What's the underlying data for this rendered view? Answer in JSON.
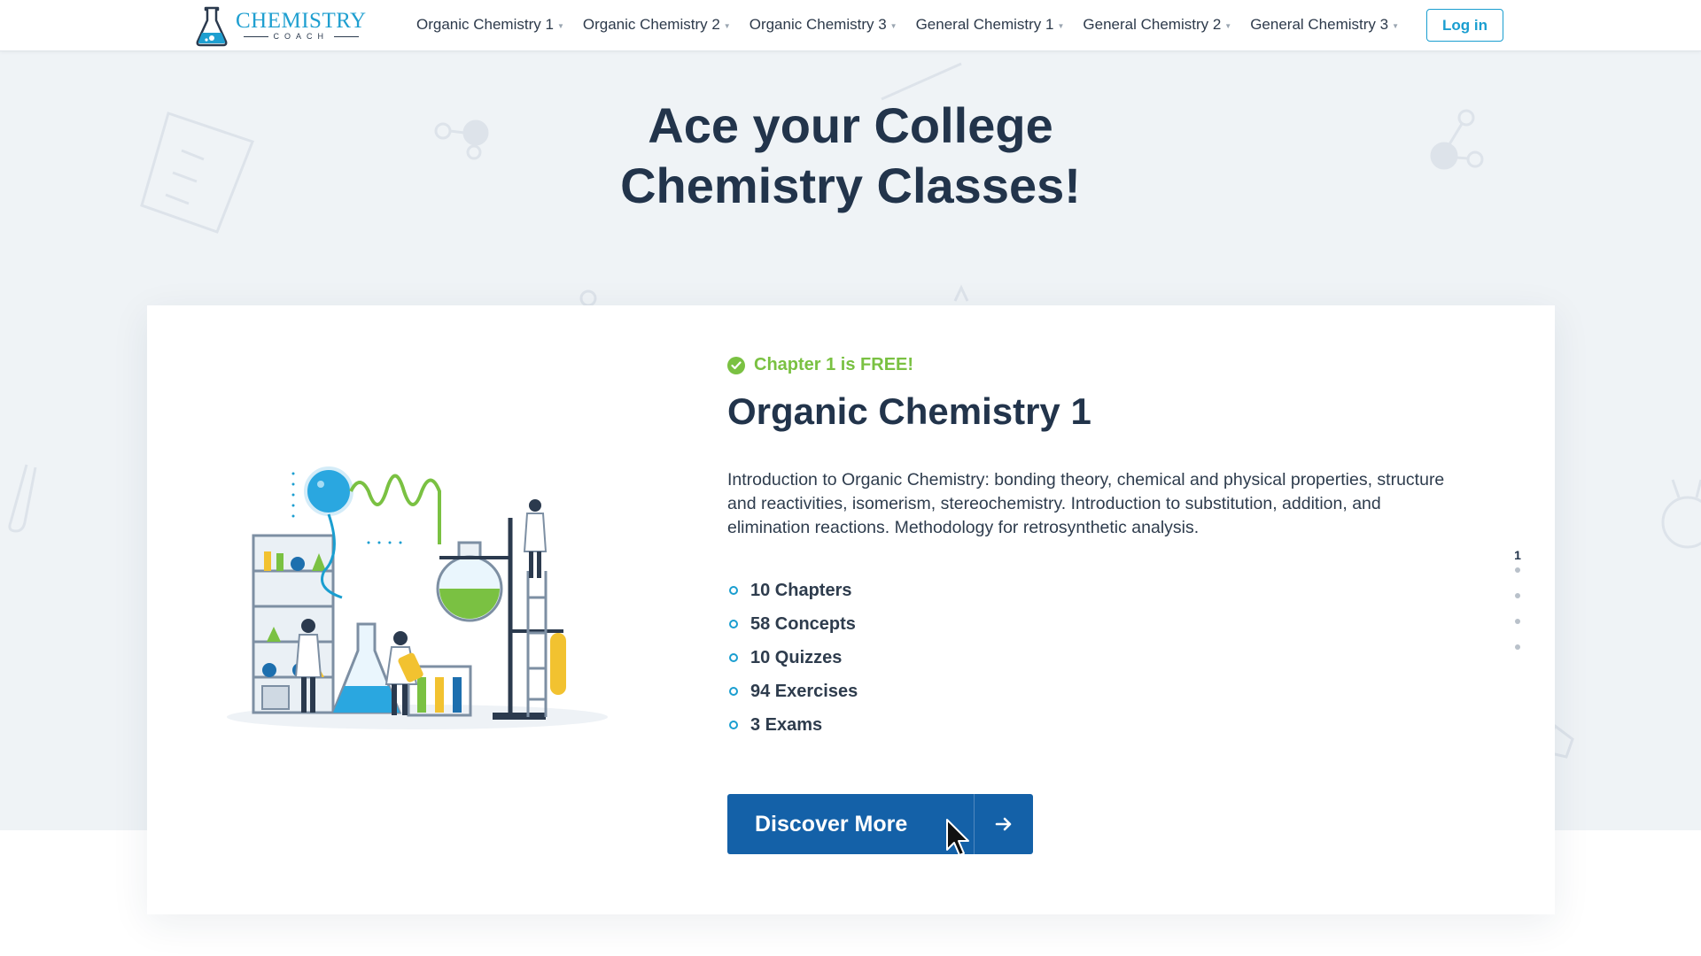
{
  "header": {
    "logo": {
      "main": "CHEMISTRY",
      "sub": "COACH"
    },
    "menu": [
      {
        "label": "Organic Chemistry 1"
      },
      {
        "label": "Organic Chemistry 2"
      },
      {
        "label": "Organic Chemistry 3"
      },
      {
        "label": "General Chemistry 1"
      },
      {
        "label": "General Chemistry 2"
      },
      {
        "label": "General Chemistry 3"
      }
    ],
    "login_label": "Log in"
  },
  "hero": {
    "title_line1": "Ace your College",
    "title_line2": "Chemistry Classes!"
  },
  "course_card": {
    "badge": "Chapter 1 is FREE!",
    "title": "Organic Chemistry 1",
    "description": "Introduction to Organic Chemistry: bonding theory, chemical and physical properties, structure and reactivities, isomerism, stereochemistry. Introduction to substitution, addition, and elimination reactions. Methodology for retrosynthetic analysis.",
    "stats": [
      {
        "label": "10 Chapters"
      },
      {
        "label": "58 Concepts"
      },
      {
        "label": "10 Quizzes"
      },
      {
        "label": "94 Exercises"
      },
      {
        "label": "3 Exams"
      }
    ],
    "cta_label": "Discover More",
    "pager": {
      "current": "1",
      "total_dots": 4
    }
  },
  "colors": {
    "brand_blue": "#1a9ed0",
    "cta_blue": "#1461a8",
    "free_green": "#7ac142",
    "heading": "#22344b",
    "background": "#eff3f6"
  },
  "icons": {
    "logo": "flask-icon",
    "caret": "caret-down-icon",
    "badge": "check-circle-icon",
    "cta": "arrow-right-icon",
    "pointer": "mouse-cursor-icon"
  }
}
